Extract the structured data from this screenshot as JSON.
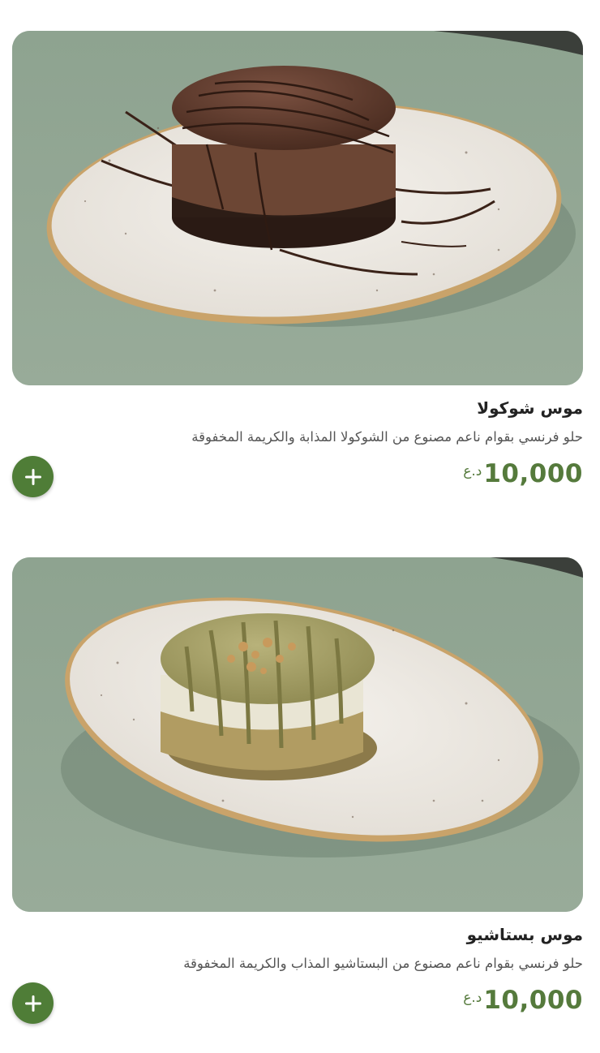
{
  "items": [
    {
      "title": "موس شوكولا",
      "description": "حلو فرنسي بقوام ناعم مصنوع من الشوكولا المذابة والكريمة المخفوقة",
      "price": "10,000",
      "currency": "د.ع",
      "image": "chocolate-mousse-photo",
      "add_icon": "plus-icon"
    },
    {
      "title": "موس بستاشيو",
      "description": "حلو فرنسي بقوام ناعم مصنوع من البستاشيو المذاب والكريمة المخفوقة",
      "price": "10,000",
      "currency": "د.ع",
      "image": "pistachio-mousse-photo",
      "add_icon": "plus-icon"
    }
  ],
  "colors": {
    "accent": "#557a3c",
    "button": "#4f7d37",
    "background": "#ffffff",
    "table": "#8fa493"
  }
}
